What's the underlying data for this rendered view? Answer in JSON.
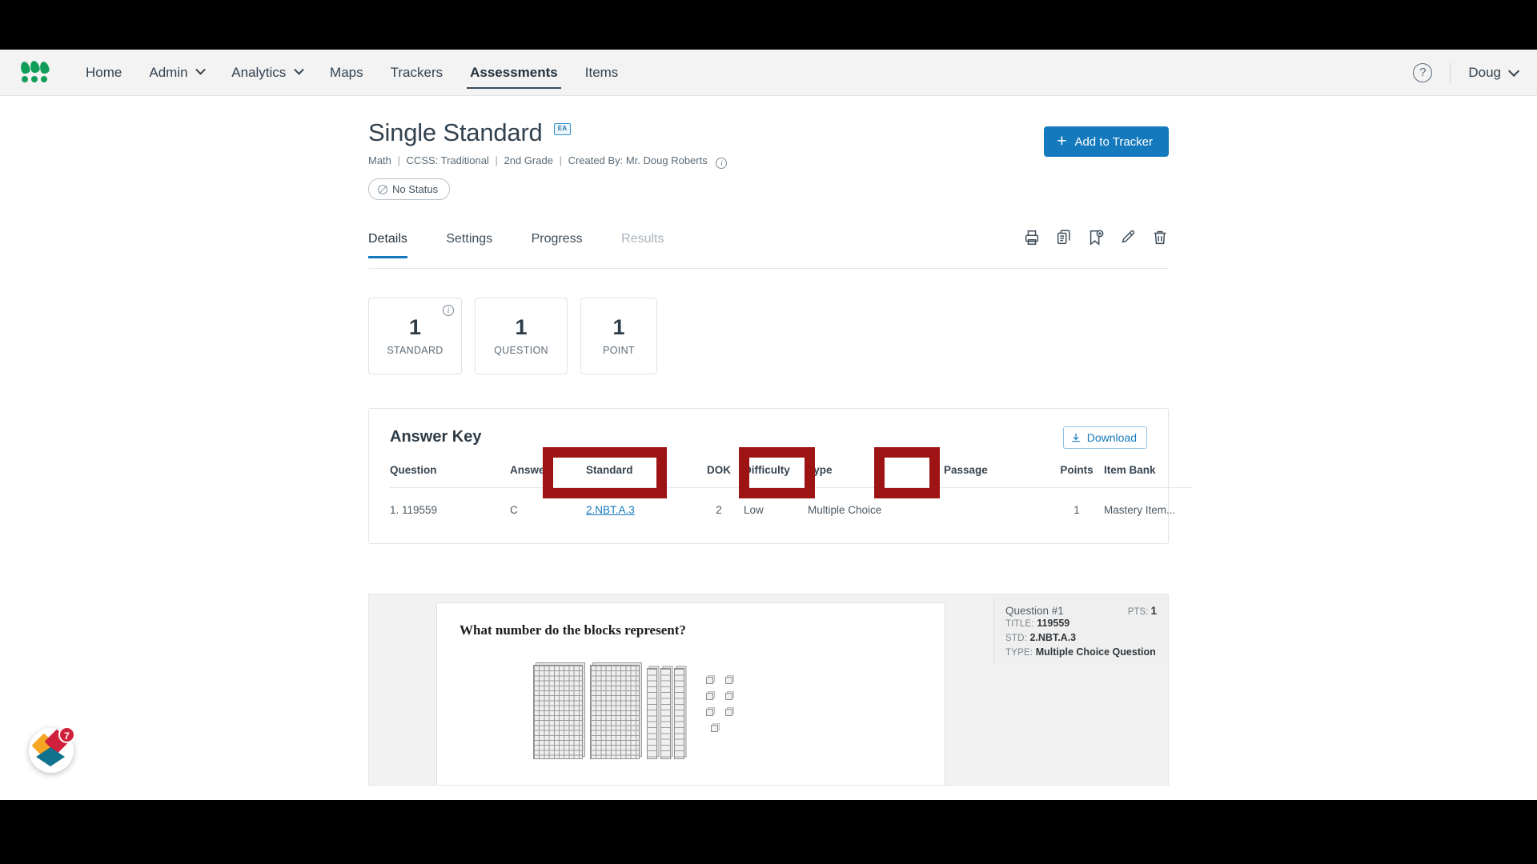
{
  "nav": {
    "logo": "illuminate-logo",
    "links": [
      {
        "label": "Home",
        "dropdown": false,
        "active": false
      },
      {
        "label": "Admin",
        "dropdown": true,
        "active": false
      },
      {
        "label": "Analytics",
        "dropdown": true,
        "active": false
      },
      {
        "label": "Maps",
        "dropdown": false,
        "active": false
      },
      {
        "label": "Trackers",
        "dropdown": false,
        "active": false
      },
      {
        "label": "Assessments",
        "dropdown": false,
        "active": true
      },
      {
        "label": "Items",
        "dropdown": false,
        "active": false
      }
    ],
    "help_icon": "question-mark-circle-icon",
    "help_label": "?",
    "user_label": "Doug"
  },
  "header": {
    "title": "Single Standard",
    "badge": "EA",
    "meta": {
      "subject": "Math",
      "standards": "CCSS: Traditional",
      "grade": "2nd Grade",
      "creator": "Created By: Mr. Doug Roberts",
      "info_icon": "info-circle-icon"
    },
    "status": "No Status",
    "add_to_tracker": "Add to Tracker"
  },
  "tabs": [
    {
      "label": "Details",
      "active": true,
      "disabled": false
    },
    {
      "label": "Settings",
      "active": false,
      "disabled": false
    },
    {
      "label": "Progress",
      "active": false,
      "disabled": false
    },
    {
      "label": "Results",
      "active": false,
      "disabled": true
    }
  ],
  "tab_actions": [
    {
      "name": "print-icon"
    },
    {
      "name": "duplicate-icon"
    },
    {
      "name": "bookmark-add-icon"
    },
    {
      "name": "edit-pencil-icon"
    },
    {
      "name": "delete-trash-icon"
    }
  ],
  "stats": [
    {
      "value": "1",
      "label": "STANDARD",
      "info": true
    },
    {
      "value": "1",
      "label": "QUESTION",
      "info": false
    },
    {
      "value": "1",
      "label": "POINT",
      "info": false
    }
  ],
  "answer_key": {
    "title": "Answer Key",
    "download_label": "Download",
    "download_icon": "download-icon",
    "columns": [
      "Question",
      "Answer",
      "Standard",
      "DOK",
      "Difficulty",
      "Type",
      "Passage",
      "Points",
      "Item Bank"
    ],
    "rows": [
      {
        "question": "1. 119559",
        "answer": "C",
        "standard": "2.NBT.A.3",
        "dok": "2",
        "difficulty": "Low",
        "type": "Multiple Choice",
        "passage": "",
        "points": "1",
        "item_bank": "Mastery Item..."
      }
    ],
    "highlights": [
      {
        "name": "dok-difficulty-highlight"
      },
      {
        "name": "passage-highlight"
      },
      {
        "name": "item-bank-highlight"
      }
    ]
  },
  "question_preview": {
    "prompt": "What number do the blocks represent?",
    "blocks": {
      "hundreds_flats": 2,
      "tens_rods": 3,
      "ones_units": 7
    },
    "meta": {
      "heading": "Question #1",
      "pts_label": "PTS:",
      "pts_value": "1",
      "title_label": "TITLE:",
      "title_value": "119559",
      "std_label": "STD:",
      "std_value": "2.NBT.A.3",
      "type_label": "TYPE:",
      "type_value": "Multiple Choice Question"
    }
  },
  "float_badge": {
    "name": "notification-badge",
    "count": "7"
  },
  "colors": {
    "accent_blue": "#1479bd",
    "nav_bg": "#f3f3f3",
    "text_dark": "#33424f",
    "annotation_red": "#9e1414",
    "logo_green": "#0f9d58"
  }
}
